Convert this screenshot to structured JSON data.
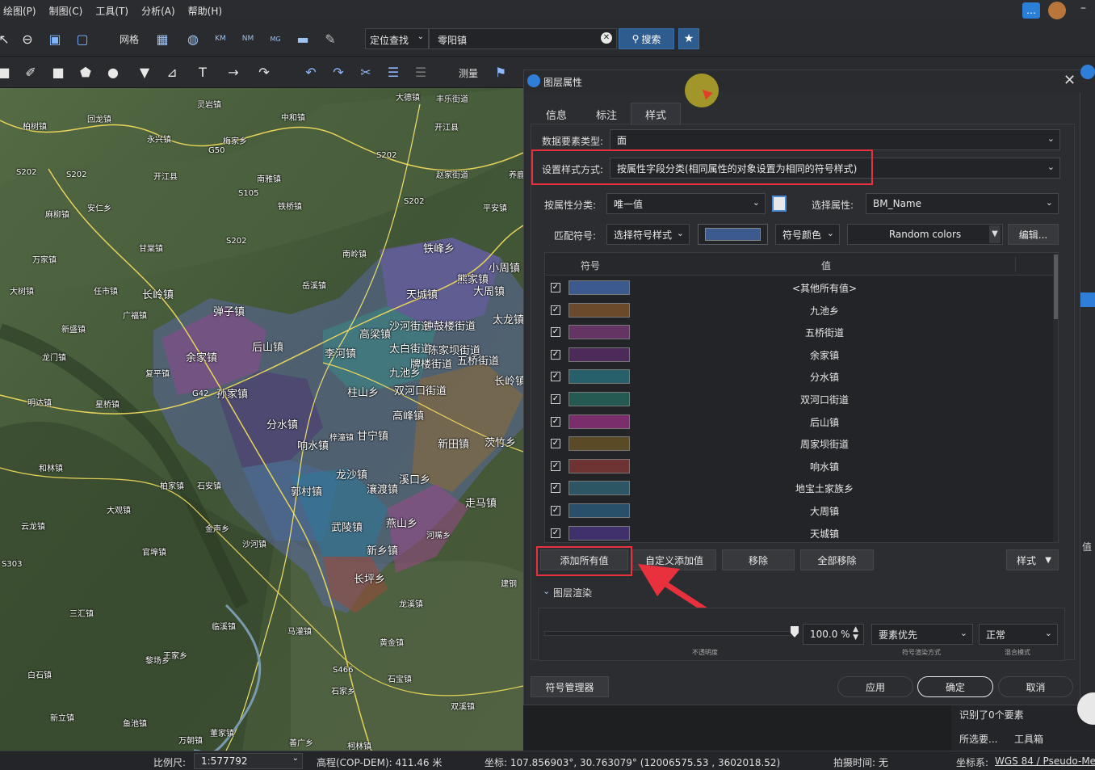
{
  "menu": [
    "绘图(P)",
    "制图(C)",
    "工具(T)",
    "分析(A)",
    "帮助(H)"
  ],
  "toolbar1": {
    "grid_label": "网格",
    "locate_label": "定位查找",
    "search_value": "零阳镇",
    "search_button": "搜索"
  },
  "toolbar2": {
    "measure_label": "测量"
  },
  "dialog": {
    "title": "图层属性",
    "tabs": [
      "信息",
      "标注",
      "样式"
    ],
    "active_tab": "样式",
    "data_type_label": "数据要素类型:",
    "data_type_value": "面",
    "style_mode_label": "设置样式方式:",
    "style_mode_value": "按属性字段分类(相同属性的对象设置为相同的符号样式)",
    "classify_label": "按属性分类:",
    "classify_value": "唯一值",
    "select_attr_label": "选择属性:",
    "select_attr_value": "BM_Name",
    "match_symbol_label": "匹配符号:",
    "choose_symbol_style": "选择符号样式",
    "symbol_color_label": "符号颜色",
    "color_scheme": "Random colors",
    "edit_button": "编辑...",
    "grid_headers": [
      "符号",
      "值"
    ],
    "rows": [
      {
        "color": "#3d5a8f",
        "value": "<其他所有值>"
      },
      {
        "color": "#6b4a2c",
        "value": "九池乡"
      },
      {
        "color": "#643462",
        "value": "五桥街道"
      },
      {
        "color": "#4c2a5a",
        "value": "余家镇"
      },
      {
        "color": "#27606a",
        "value": "分水镇"
      },
      {
        "color": "#245a52",
        "value": "双河口街道"
      },
      {
        "color": "#7a2e6c",
        "value": "后山镇"
      },
      {
        "color": "#5a4a25",
        "value": "周家坝街道"
      },
      {
        "color": "#6e3434",
        "value": "响水镇"
      },
      {
        "color": "#2c5664",
        "value": "地宝土家族乡"
      },
      {
        "color": "#29506a",
        "value": "大周镇"
      },
      {
        "color": "#40306c",
        "value": "天城镇"
      }
    ],
    "add_all_button": "添加所有值",
    "custom_add_button": "自定义添加值",
    "remove_button": "移除",
    "remove_all_button": "全部移除",
    "style_button": "样式",
    "render_section": "图层渲染",
    "opacity_value": "100.0 %",
    "opacity_caption": "不透明度",
    "render_mode_value": "要素优先",
    "render_mode_caption": "符号渲染方式",
    "blend_value": "正常",
    "blend_caption": "混合模式",
    "symbol_manager_button": "符号管理器",
    "apply_button": "应用",
    "ok_button": "确定",
    "cancel_button": "取消"
  },
  "right_panel": {
    "identified_text": "识别了0个要素",
    "selected_label": "所选要...",
    "toolbox_label": "工具箱",
    "value_label": "值"
  },
  "status": {
    "scale_label": "比例尺:",
    "scale_value": "1:577792",
    "elevation": "高程(COP-DEM): 411.46 米",
    "coords": "坐标: 107.856903°, 30.763079°  (12006575.53 , 3602018.52)",
    "capture_time": "拍摄时间: 无",
    "crs_label": "坐标系:",
    "crs_value": "WGS 84 / Pseudo-Me"
  },
  "map_labels": [
    "灵岩镇",
    "大德镇",
    "丰乐街道",
    "柏树镇",
    "回龙镇",
    "中和镇",
    "永兴镇",
    "梅家乡",
    "开江县",
    "S202",
    "S202",
    "开江县",
    "南雅镇",
    "赵家街道",
    "养鹿",
    "S202",
    "麻柳镇",
    "安仁乡",
    "铁桥镇",
    "S202",
    "平安镇",
    "甘棠镇",
    "万家镇",
    "S202",
    "南岭镇",
    "铁峰乡",
    "熊家镇",
    "小周镇",
    "大树镇",
    "任市镇",
    "长岭镇",
    "岳溪镇",
    "天城镇",
    "大周镇",
    "太龙镇",
    "广福镇",
    "弹子镇",
    "高梁镇",
    "沙河街道",
    "钟鼓楼街道",
    "新盛镇",
    "余家镇",
    "后山镇",
    "李河镇",
    "太白街道",
    "陈家坝街道",
    "五桥街道",
    "龙门镇",
    "复平镇",
    "九池乡",
    "牌楼街道",
    "G42",
    "孙家镇",
    "柱山乡",
    "双河口街道",
    "长岭镇",
    "明达镇",
    "星桥镇",
    "高峰镇",
    "分水镇",
    "甘宁镇",
    "新田镇",
    "茨竹乡",
    "响水镇",
    "梓潼镇",
    "和林镇",
    "柏家镇",
    "石安镇",
    "龙沙镇",
    "郭村镇",
    "瀼渡镇",
    "溪口乡",
    "走马镇",
    "大观镇",
    "燕山乡",
    "武陵镇",
    "河嘴乡",
    "云龙镇",
    "金声乡",
    "新乡镇",
    "官埠镇",
    "长坪乡",
    "建钢",
    "沙河镇",
    "S303",
    "龙溪镇",
    "三汇镇",
    "临溪镇",
    "马灌镇",
    "黄金镇",
    "黎场乡",
    "王家乡",
    "S466",
    "石宝镇",
    "白石镇",
    "石家乡",
    "新立镇",
    "鱼池镇",
    "董家镇",
    "双溪镇",
    "善广乡",
    "乌杨街道",
    "柯林镇",
    "万朝镇",
    "G50",
    "S105"
  ]
}
